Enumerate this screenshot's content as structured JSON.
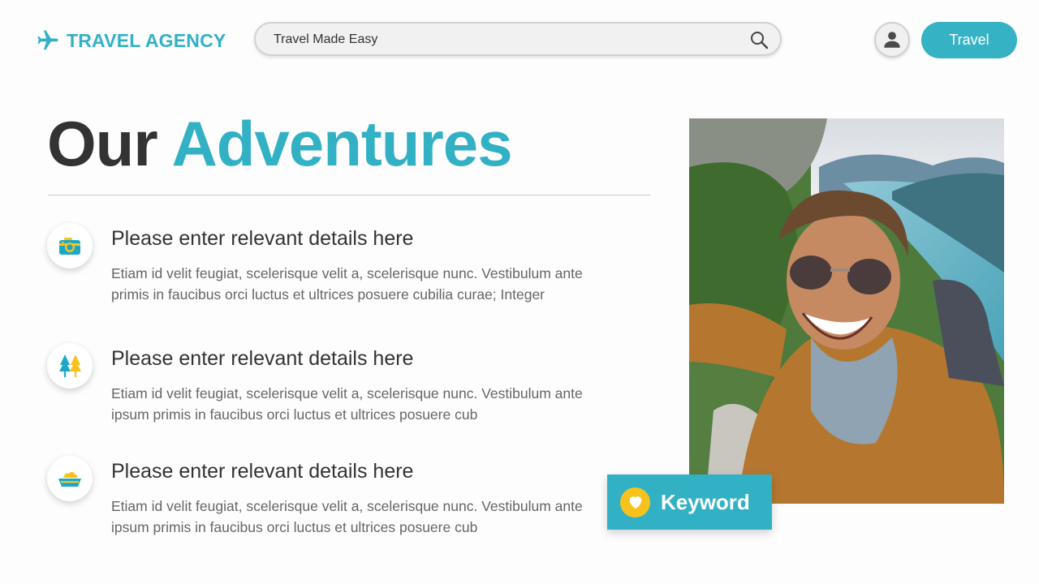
{
  "header": {
    "brand": "TRAVEL AGENCY",
    "search": {
      "value": "Travel Made Easy",
      "placeholder": ""
    },
    "cta_label": "Travel"
  },
  "hero": {
    "title_dark": "Our",
    "title_accent": "Adventures"
  },
  "features": [
    {
      "icon": "camera-icon",
      "heading": "Please enter relevant details here",
      "body": "Etiam id velit feugiat, scelerisque velit a, scelerisque nunc. Vestibulum ante primis in faucibus orci luctus et ultrices posuere cubilia curae; Integer"
    },
    {
      "icon": "trees-icon",
      "heading": "Please enter relevant details here",
      "body": "Etiam id velit feugiat, scelerisque velit a, scelerisque nunc. Vestibulum ante ipsum primis in faucibus orci luctus et ultrices posuere cub"
    },
    {
      "icon": "boat-icon",
      "heading": "Please enter relevant details here",
      "body": "Etiam id velit feugiat, scelerisque velit a, scelerisque nunc. Vestibulum ante ipsum primis in faucibus orci luctus et ultrices posuere cub"
    }
  ],
  "badge": {
    "icon": "heart-icon",
    "label": "Keyword"
  },
  "colors": {
    "accent": "#33b1c4",
    "heading_dark": "#333333",
    "badge_icon": "#f7c21c"
  }
}
